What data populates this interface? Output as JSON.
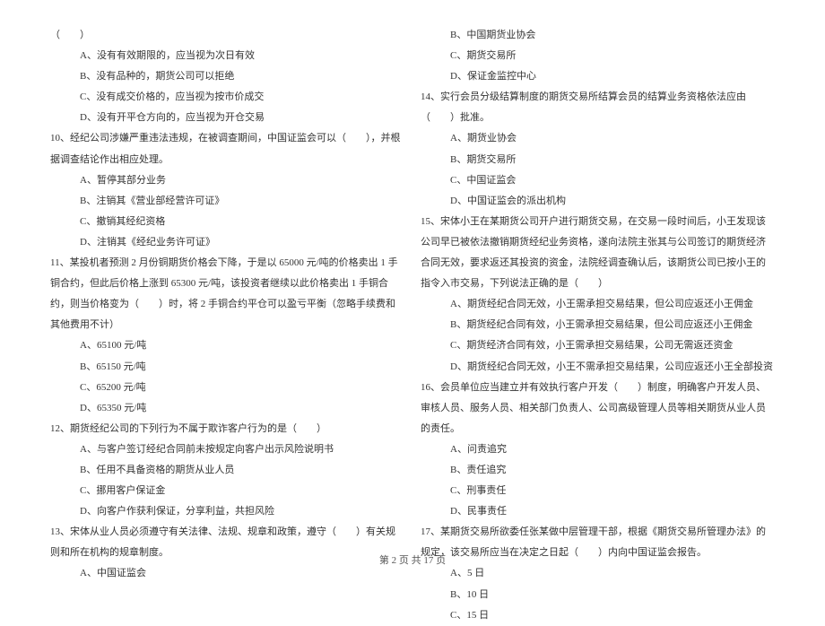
{
  "left": {
    "l1": "（　　）",
    "l2": "A、没有有效期限的，应当视为次日有效",
    "l3": "B、没有品种的，期货公司可以拒绝",
    "l4": "C、没有成交价格的，应当视为按市价成交",
    "l5": "D、没有开平仓方向的，应当视为开仓交易",
    "q10": "10、经纪公司涉嫌严重违法违规，在被调查期间，中国证监会可以（　　），并根据调查结论作出相应处理。",
    "l7": "A、暂停其部分业务",
    "l8": "B、注销其《营业部经营许可证》",
    "l9": "C、撤销其经纪资格",
    "l10": "D、注销其《经纪业务许可证》",
    "q11": "11、某投机者预测 2 月份铜期货价格会下降，于是以 65000 元/吨的价格卖出 1 手铜合约，但此后价格上涨到 65300 元/吨，该投资者继续以此价格卖出 1 手铜合约，则当价格变为（　　）时，将 2 手铜合约平仓可以盈亏平衡（忽略手续费和其他费用不计）",
    "l12": "A、65100 元/吨",
    "l13": "B、65150 元/吨",
    "l14": "C、65200 元/吨",
    "l15": "D、65350 元/吨",
    "q12": "12、期货经纪公司的下列行为不属于欺诈客户行为的是（　　）",
    "l17": "A、与客户签订经纪合同前未按规定向客户出示风险说明书",
    "l18": "B、任用不具备资格的期货从业人员",
    "l19": "C、挪用客户保证金",
    "l20": "D、向客户作获利保证，分享利益，共担风险",
    "q13": "13、宋体从业人员必须遵守有关法律、法规、规章和政策，遵守（　　）有关规则和所在机构的规章制度。",
    "l22": "A、中国证监会"
  },
  "right": {
    "r1": "B、中国期货业协会",
    "r2": "C、期货交易所",
    "r3": "D、保证金监控中心",
    "q14": "14、实行会员分级结算制度的期货交易所结算会员的结算业务资格依法应由（　　）批准。",
    "r5": "A、期货业协会",
    "r6": "B、期货交易所",
    "r7": "C、中国证监会",
    "r8": "D、中国证监会的派出机构",
    "q15": "15、宋体小王在某期货公司开户进行期货交易，在交易一段时间后，小王发现该公司早已被依法撤销期货经纪业务资格，遂向法院主张其与公司签订的期货经济合同无效，要求返还其投资的资金，法院经调查确认后，该期货公司已按小王的指令入市交易，下列说法正确的是（　　）",
    "r10": "A、期货经纪合同无效，小王需承担交易结果，但公司应返还小王佣金",
    "r11": "B、期货经纪合同有效，小王需承担交易结果，但公司应返还小王佣金",
    "r12": "C、期货经济合同有效，小王需承担交易结果，公司无需返还资金",
    "r13": "D、期货经纪合同无效，小王不需承担交易结果，公司应返还小王全部投资",
    "q16": "16、会员单位应当建立并有效执行客户开发（　　）制度，明确客户开发人员、审核人员、服务人员、相关部门负责人、公司高级管理人员等相关期货从业人员的责任。",
    "r15": "A、问责追究",
    "r16": "B、责任追究",
    "r17": "C、刑事责任",
    "r18": "D、民事责任",
    "q17": "17、某期货交易所欲委任张某做中层管理干部，根据《期货交易所管理办法》的规定，该交易所应当在决定之日起（　　）内向中国证监会报告。",
    "r20": "A、5 日",
    "r21": "B、10 日",
    "r22": "C、15 日"
  },
  "footer": "第 2 页 共 17 页"
}
